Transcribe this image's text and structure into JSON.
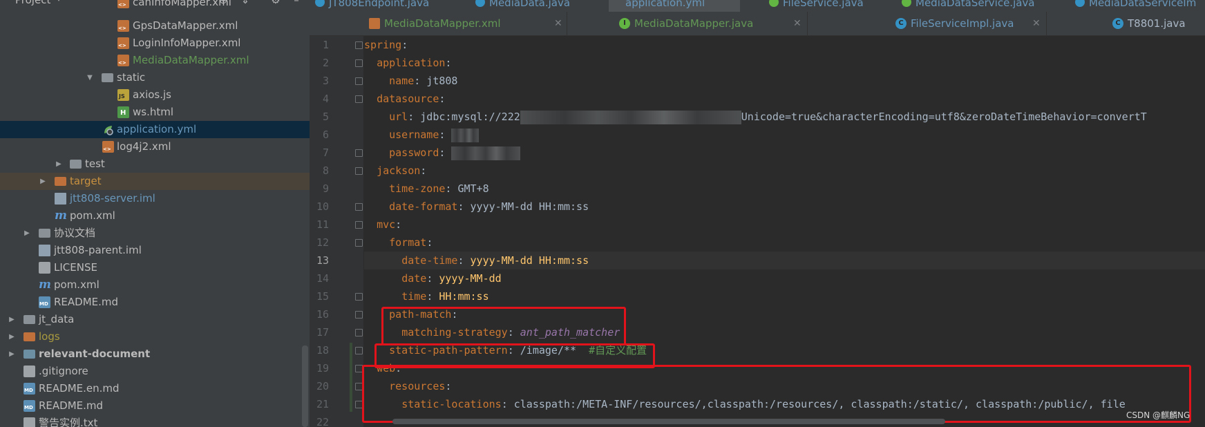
{
  "project_panel": {
    "title": "Project",
    "tree": [
      {
        "label": "canInfoMapper.xml",
        "icon": "xml-file-icon"
      },
      {
        "label": "GpsDataMapper.xml",
        "icon": "xml-file-icon"
      },
      {
        "label": "LoginInfoMapper.xml",
        "icon": "xml-file-icon"
      },
      {
        "label": "MediaDataMapper.xml",
        "icon": "xml-file-icon"
      },
      {
        "label": "static",
        "icon": "folder-icon"
      },
      {
        "label": "axios.js",
        "icon": "js-file-icon"
      },
      {
        "label": "ws.html",
        "icon": "html-file-icon"
      },
      {
        "label": "application.yml",
        "icon": "yml-file-icon"
      },
      {
        "label": "log4j2.xml",
        "icon": "xml-file-icon"
      },
      {
        "label": "test",
        "icon": "folder-icon"
      },
      {
        "label": "target",
        "icon": "folder-icon"
      },
      {
        "label": "jtt808-server.iml",
        "icon": "iml-file-icon"
      },
      {
        "label": "pom.xml",
        "icon": "maven-icon"
      },
      {
        "label": "协议文档",
        "icon": "folder-icon"
      },
      {
        "label": "jtt808-parent.iml",
        "icon": "iml-file-icon"
      },
      {
        "label": "LICENSE",
        "icon": "text-file-icon"
      },
      {
        "label": "pom.xml",
        "icon": "maven-icon"
      },
      {
        "label": "README.md",
        "icon": "md-file-icon"
      },
      {
        "label": "jt_data",
        "icon": "folder-icon"
      },
      {
        "label": "logs",
        "icon": "folder-icon"
      },
      {
        "label": "relevant-document",
        "icon": "folder-icon"
      },
      {
        "label": ".gitignore",
        "icon": "text-file-icon"
      },
      {
        "label": "README.en.md",
        "icon": "md-file-icon"
      },
      {
        "label": "README.md",
        "icon": "md-file-icon"
      },
      {
        "label": "警告实例.txt",
        "icon": "text-file-icon"
      }
    ]
  },
  "editor_tabs_top": [
    {
      "label": "JT808Endpoint.java"
    },
    {
      "label": "MediaData.java"
    },
    {
      "label": "application.yml"
    },
    {
      "label": "FileService.java"
    },
    {
      "label": "MediaDataService.java"
    },
    {
      "label": "MediaDataServiceIm"
    }
  ],
  "editor_tabs": [
    {
      "label": "MediaDataMapper.xml",
      "icon": "xml-file-icon"
    },
    {
      "label": "MediaDataMapper.java",
      "icon": "interface-icon"
    },
    {
      "label": "FileServiceImpl.java",
      "icon": "class-icon"
    },
    {
      "label": "T8801.java",
      "icon": "class-icon"
    }
  ],
  "code": {
    "line_numbers": [
      "1",
      "2",
      "3",
      "4",
      "5",
      "6",
      "7",
      "8",
      "9",
      "10",
      "11",
      "12",
      "13",
      "14",
      "15",
      "16",
      "17",
      "18",
      "19",
      "20",
      "21",
      "22"
    ],
    "current_line": "13",
    "l1": "spring",
    "l2": "application",
    "l3_key": "name",
    "l3_val": "jt808",
    "l4": "datasource",
    "l5_key": "url",
    "l5_val_a": "jdbc:mysql://222",
    "l5_val_b": "Unicode=true&characterEncoding=utf8&zeroDateTimeBehavior=convertT",
    "l6_key": "username",
    "l7_key": "password",
    "l8": "jackson",
    "l9_key": "time-zone",
    "l9_val": "GMT+8",
    "l10_key": "date-format",
    "l10_val": "yyyy-MM-dd HH:mm:ss",
    "l11": "mvc",
    "l12": "format",
    "l13_key": "date-time",
    "l13_val": "yyyy-MM-dd HH:mm:ss",
    "l14_key": "date",
    "l14_val": "yyyy-MM-dd",
    "l15_key": "time",
    "l15_val": "HH:mm:ss",
    "l16": "path-match",
    "l17_key": "matching-strategy",
    "l17_val": "ant_path_matcher",
    "l18_key": "static-path-pattern",
    "l18_val": "/image/**",
    "l18_comment": "#自定义配置",
    "l19": "web",
    "l20": "resources",
    "l21_key": "static-locations",
    "l21_val": "classpath:/META-INF/resources/,classpath:/resources/, classpath:/static/, classpath:/public/, file"
  },
  "watermark": "CSDN @麒麟NG",
  "colors": {
    "keyword": "#cc7832",
    "value": "#a9b7c6",
    "highlight_value": "#ffc66d",
    "enum": "#9876aa",
    "comment": "#629755",
    "annotation_box": "#e3131b"
  }
}
